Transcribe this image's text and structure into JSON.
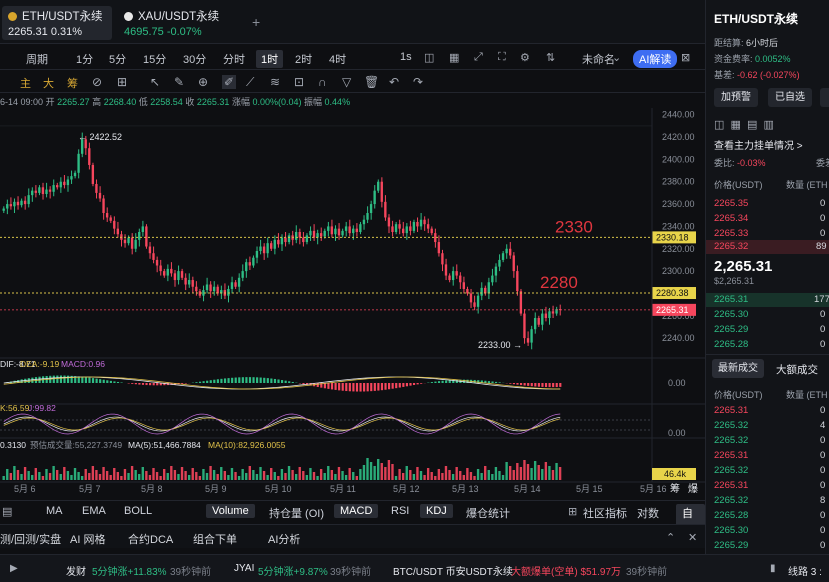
{
  "tabs": [
    {
      "name": "ETH/USDT永续",
      "price": "2265.31",
      "change": "0.31%"
    },
    {
      "name": "XAU/USDT永续",
      "price": "4695.75",
      "change": "-0.07%"
    }
  ],
  "add_tab": "+",
  "timeframes": {
    "period": "周期",
    "items": [
      "1分",
      "5分",
      "15分",
      "30分",
      "分时",
      "1时",
      "2时",
      "4时"
    ],
    "selected": "1时",
    "speed": "1s",
    "layout": "未命名",
    "ai": "AI解读"
  },
  "toolbar": {
    "items": [
      "主",
      "大",
      "筹"
    ]
  },
  "info_line": {
    "date": "6-14 09:00",
    "open_label": "开",
    "open": "2265.27",
    "high_label": "高",
    "high": "2268.40",
    "low_label": "低",
    "low": "2258.54",
    "close_label": "收",
    "close": "2265.31",
    "chg_label": "涨幅",
    "chg": "0.00%(0.04)",
    "amp_label": "振幅",
    "amp": "0.44%"
  },
  "chart_data": {
    "type": "candlestick",
    "x_labels": [
      "5月 6",
      "5月 7",
      "5月 8",
      "5月 9",
      "5月 10",
      "5月 11",
      "5月 12",
      "5月 13",
      "5月 14",
      "5月 15",
      "5月 16"
    ],
    "y_ticks": [
      2440,
      2420,
      2400,
      2380,
      2360,
      2340,
      2320,
      2300,
      2280,
      2260,
      2240
    ],
    "ylim": [
      2224,
      2446
    ],
    "high_label": "2422.52",
    "low_label": "2233.00",
    "levels": [
      {
        "value": 2330.18,
        "label": "2330.18",
        "annotation": "2330"
      },
      {
        "value": 2280.38,
        "label": "2280.38",
        "annotation": "2280"
      }
    ],
    "last_price": {
      "value": 2265.31,
      "label": "2265.31"
    },
    "closes": [
      2356,
      2360,
      2358,
      2362,
      2359,
      2363,
      2360,
      2368,
      2372,
      2370,
      2375,
      2369,
      2373,
      2371,
      2377,
      2375,
      2380,
      2377,
      2382,
      2385,
      2388,
      2405,
      2418,
      2410,
      2395,
      2378,
      2370,
      2365,
      2352,
      2348,
      2345,
      2338,
      2333,
      2328,
      2325,
      2330,
      2320,
      2328,
      2335,
      2340,
      2322,
      2316,
      2310,
      2305,
      2300,
      2296,
      2302,
      2298,
      2292,
      2300,
      2294,
      2288,
      2292,
      2286,
      2282,
      2278,
      2283,
      2288,
      2282,
      2286,
      2280,
      2283,
      2278,
      2284,
      2290,
      2286,
      2294,
      2300,
      2308,
      2305,
      2312,
      2318,
      2322,
      2316,
      2325,
      2320,
      2328,
      2324,
      2330,
      2326,
      2332,
      2328,
      2335,
      2330,
      2326,
      2332,
      2336,
      2330,
      2334,
      2331,
      2336,
      2340,
      2333,
      2338,
      2332,
      2336,
      2340,
      2334,
      2338,
      2335,
      2342,
      2346,
      2352,
      2360,
      2372,
      2380,
      2362,
      2348,
      2340,
      2335,
      2342,
      2338,
      2334,
      2340,
      2336,
      2344,
      2340,
      2346,
      2342,
      2338,
      2334,
      2326,
      2316,
      2306,
      2296,
      2292,
      2300,
      2296,
      2290,
      2284,
      2280,
      2272,
      2268,
      2278,
      2285,
      2280,
      2290,
      2296,
      2304,
      2310,
      2316,
      2320,
      2314,
      2300,
      2282,
      2262,
      2240,
      2236,
      2248,
      2258,
      2252,
      2262,
      2258,
      2264,
      2262,
      2266,
      2265.31
    ],
    "macd": {
      "label": "DIF:-8.71",
      "dea": "DEA:-9.19",
      "macd": "MACD:0.96",
      "axis": "0.00"
    },
    "kdj": {
      "label": "K:56.59",
      "j": "J:99.82",
      "axis": "0.00"
    },
    "volume": {
      "label": "0.3130",
      "pred": "预估成交量:55,227.3749",
      "ma5": "MA(5):51,466.7884",
      "ma10": "MA(10):82,926.0055",
      "tag": "46.4k"
    }
  },
  "bottom_tabs": [
    "MA",
    "EMA",
    "BOLL",
    "Volume",
    "持仓量 (OI)",
    "MACD",
    "RSI",
    "KDJ",
    "爆仓统计",
    "社区指标",
    "对数",
    "自动"
  ],
  "bottom_active": [
    "Volume",
    "MACD",
    "KDJ"
  ],
  "strategy_bar": [
    "测/回测/实盘",
    "AI 网格",
    "合约DCA",
    "组合下单",
    "AI分析"
  ],
  "ticker": [
    {
      "label": "发财",
      "text": "5分钟涨+11.83%",
      "time": "39秒钟前"
    },
    {
      "label": "JYAI",
      "text": "5分钟涨+9.87%",
      "time": "39秒钟前"
    },
    {
      "label": "BTC/USDT 币安USDT永续",
      "text": "大额爆单(空单) $51.97万",
      "time": "39秒钟前"
    }
  ],
  "ticker_right": "线路 3 :",
  "side": {
    "title": "ETH/USDT永续",
    "funding_label": "距结算:",
    "funding": "6小时后",
    "rate_label": "资金费率:",
    "rate": "0.0052%",
    "basis_label": "基差:",
    "basis": "-0.62 (-0.027%)",
    "btn1": "加预警",
    "btn2": "已自选",
    "orderbook_title": "查看主力挂单情况 >",
    "ratio_label": "委比:",
    "ratio": "-0.03%",
    "ratio_right": "委差",
    "cols": [
      "价格(USDT)",
      "数量 (ETH"
    ],
    "asks": [
      {
        "p": "2265.35",
        "q": "0"
      },
      {
        "p": "2265.34",
        "q": "0"
      },
      {
        "p": "2265.33",
        "q": "0"
      },
      {
        "p": "2265.32",
        "q": "89"
      }
    ],
    "mid": "2,265.31",
    "mid_sub": "$2,265.31",
    "bids": [
      {
        "p": "2265.31",
        "q": "177"
      },
      {
        "p": "2265.30",
        "q": "0"
      },
      {
        "p": "2265.29",
        "q": "0"
      },
      {
        "p": "2265.28",
        "q": "0"
      }
    ],
    "trade_tabs": [
      "最新成交",
      "大额成交"
    ],
    "trade_cols": [
      "价格(USDT)",
      "数量 (ETH"
    ],
    "trades": [
      {
        "p": "2265.31",
        "q": "0",
        "c": "red"
      },
      {
        "p": "2265.32",
        "q": "4",
        "c": "green"
      },
      {
        "p": "2265.32",
        "q": "0",
        "c": "green"
      },
      {
        "p": "2265.31",
        "q": "0",
        "c": "red"
      },
      {
        "p": "2265.32",
        "q": "0",
        "c": "green"
      },
      {
        "p": "2265.31",
        "q": "0",
        "c": "red"
      },
      {
        "p": "2265.32",
        "q": "8",
        "c": "green"
      },
      {
        "p": "2265.28",
        "q": "0",
        "c": "green"
      },
      {
        "p": "2265.30",
        "q": "0",
        "c": "green"
      },
      {
        "p": "2265.29",
        "q": "0",
        "c": "green"
      }
    ]
  }
}
